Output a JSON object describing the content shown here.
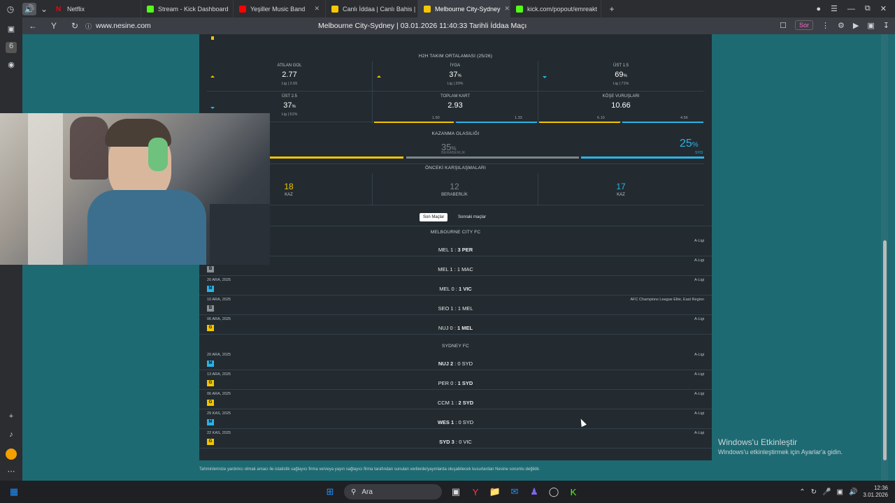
{
  "browser": {
    "tabs": [
      {
        "label": "Netflix",
        "color": "#e50914"
      },
      {
        "label": "Stream - Kick Dashboard",
        "color": "#53fc18"
      },
      {
        "label": "Yeşiller Music Band",
        "color": "#ff0000"
      },
      {
        "label": "Canlı İddaa | Canlı Bahis |",
        "color": "#f6c700"
      },
      {
        "label": "Melbourne City-Sydney",
        "color": "#f6c700"
      },
      {
        "label": "kick.com/popout/emreakt",
        "color": "#53fc18"
      }
    ],
    "url": "www.nesine.com",
    "page_title": "Melbourne City-Sydney | 03.01.2026 11:40:33 Tarihli İddaa Maçı",
    "sor_label": "Sor"
  },
  "h2h": {
    "title": "H2H TAKIM ORTALAMASI (25/26)",
    "cells": [
      {
        "label": "ATILAN GOL",
        "value": "2.77",
        "unit": "",
        "sub": "Lig | 2.65"
      },
      {
        "label": "İYGA",
        "value": "37",
        "unit": "%",
        "sub": "Lig | 20%"
      },
      {
        "label": "ÜST 1.5",
        "value": "69",
        "unit": "%",
        "sub": "Lig | 71%"
      },
      {
        "label": "ÜST 2.5",
        "value": "37",
        "unit": "%",
        "sub": "Lig | 51%"
      },
      {
        "label": "TOPLAM KART",
        "value": "2.93",
        "unit": "",
        "sub": ""
      },
      {
        "label": "KÖŞE VURUŞLARI",
        "value": "10.66",
        "unit": "",
        "sub": ""
      }
    ],
    "kart_left": "1.60",
    "kart_right": "1.33",
    "kose_left": "6.10",
    "kose_right": "4.56"
  },
  "win": {
    "title": "KAZANMA OLASILIĞI",
    "draw_pct": "35",
    "draw_label": "BERABERLİK",
    "away_pct": "25",
    "away_label": "SYD",
    "pct_sign": "%"
  },
  "previous": {
    "title": "ÖNCEKİ KARŞILAŞMALARI",
    "home_count": "18",
    "home_label": "KAZ",
    "draw_count": "12",
    "draw_label": "BERABERLİK",
    "away_count": "17",
    "away_label": "KAZ"
  },
  "tabs": {
    "recent": "Son Maçlar",
    "upcoming": "Sonraki maçlar"
  },
  "team1": {
    "name": "MELBOURNE CITY FC",
    "matches": [
      {
        "date": "",
        "badge": "",
        "home": "MEL 1",
        "sep": " : ",
        "away": "3 PER",
        "bold": "away",
        "league": "A-Ligi"
      },
      {
        "date": "",
        "badge": "B",
        "home": "MEL 1",
        "sep": " : ",
        "away": "1 MAC",
        "bold": "",
        "league": "A-Ligi"
      },
      {
        "date": "20 ARA, 2025",
        "badge": "M",
        "home": "MEL 0",
        "sep": " : ",
        "away": "1 VIC",
        "bold": "away",
        "league": "A-Ligi"
      },
      {
        "date": "10 ARA, 2025",
        "badge": "B",
        "home": "SEO 1",
        "sep": " : ",
        "away": "1 MEL",
        "bold": "",
        "league": "AFC Champions League Elite, East Region"
      },
      {
        "date": "06 ARA, 2025",
        "badge": "G",
        "home": "NUJ 0",
        "sep": " : ",
        "away": "1 MEL",
        "bold": "away",
        "league": "A-Ligi"
      }
    ]
  },
  "team2": {
    "name": "SYDNEY FC",
    "matches": [
      {
        "date": "20 ARA, 2025",
        "badge": "M",
        "home": "NUJ 2",
        "sep": " : ",
        "away": "0 SYD",
        "bold": "home",
        "league": "A-Ligi"
      },
      {
        "date": "13 ARA, 2025",
        "badge": "G",
        "home": "PER 0",
        "sep": " : ",
        "away": "1 SYD",
        "bold": "away",
        "league": "A-Ligi"
      },
      {
        "date": "06 ARA, 2025",
        "badge": "G",
        "home": "CCM 1",
        "sep": " : ",
        "away": "2 SYD",
        "bold": "away",
        "league": "A-Ligi"
      },
      {
        "date": "29 KAS, 2025",
        "badge": "M",
        "home": "WES 1",
        "sep": " : ",
        "away": "0 SYD",
        "bold": "home",
        "league": "A-Ligi"
      },
      {
        "date": "22 KAS, 2025",
        "badge": "G",
        "home": "SYD 3",
        "sep": " : ",
        "away": "0 VIC",
        "bold": "home",
        "league": "A-Ligi"
      }
    ]
  },
  "footer_note": "Tahminlerinize yardımcı olmak amacı ile istatistik sağlayıcı firma ve/veya yayın sağlayıcı firma tarafından sunulan verilerde/yayınlarda oluşabilecek kusurlardan Nesine sorumlu değildir.",
  "watermark": {
    "line1": "Windows'u Etkinleştir",
    "line2": "Windows'u etkinleştirmek için Ayarlar'a gidin."
  },
  "taskbar": {
    "search": "Ara",
    "time": "12:36",
    "date": "3.01.2026"
  },
  "badge_colors": {
    "G": "#f2c500",
    "B": "#8a9096",
    "M": "#2bb3e6"
  }
}
